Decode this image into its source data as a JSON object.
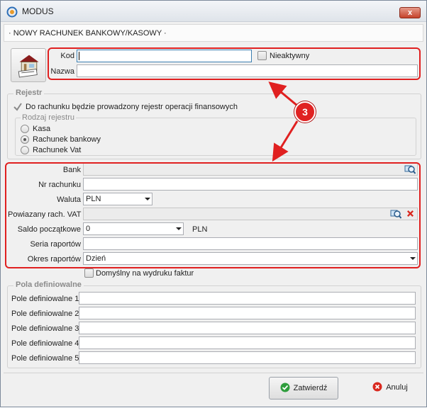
{
  "window": {
    "title": "MODUS",
    "close_label": "x"
  },
  "form_header": "· NOWY RACHUNEK BANKOWY/KASOWY ·",
  "fields": {
    "kod": {
      "label": "Kod",
      "value": ""
    },
    "nieaktywny": {
      "label": "Nieaktywny",
      "checked": false
    },
    "nazwa": {
      "label": "Nazwa",
      "value": ""
    }
  },
  "rejestr": {
    "title": "Rejestr",
    "checkbox_label": "Do rachunku będzie prowadzony rejestr operacji finansowych",
    "checked": true,
    "rodzaj": {
      "title": "Rodzaj rejestru",
      "options": [
        "Kasa",
        "Rachunek bankowy",
        "Rachunek Vat"
      ],
      "selected": "Rachunek bankowy"
    }
  },
  "bank_section": {
    "bank": {
      "label": "Bank",
      "value": ""
    },
    "nr_rachunku": {
      "label": "Nr rachunku",
      "value": ""
    },
    "waluta": {
      "label": "Waluta",
      "value": "PLN"
    },
    "powiazany": {
      "label": "Powiazany rach. VAT",
      "value": ""
    },
    "saldo": {
      "label": "Saldo początkowe",
      "value": "0",
      "currency": "PLN"
    },
    "seria": {
      "label": "Seria raportów",
      "value": ""
    },
    "okres": {
      "label": "Okres raportów",
      "value": "Dzień"
    }
  },
  "domyslny": {
    "label": "Domyślny na wydruku faktur",
    "checked": false
  },
  "pola": {
    "title": "Pola definiowalne",
    "items": [
      {
        "label": "Pole definiowalne 1",
        "value": ""
      },
      {
        "label": "Pole definiowalne 2",
        "value": ""
      },
      {
        "label": "Pole definiowalne 3",
        "value": ""
      },
      {
        "label": "Pole definiowalne 4",
        "value": ""
      },
      {
        "label": "Pole definiowalne 5",
        "value": ""
      }
    ]
  },
  "buttons": {
    "ok": "Zatwierdź",
    "cancel": "Anuluj"
  },
  "annotation": {
    "badge": "3"
  },
  "colors": {
    "annotation": "#e02020",
    "accept": "#2e9d3c",
    "cancel": "#d9281e"
  }
}
